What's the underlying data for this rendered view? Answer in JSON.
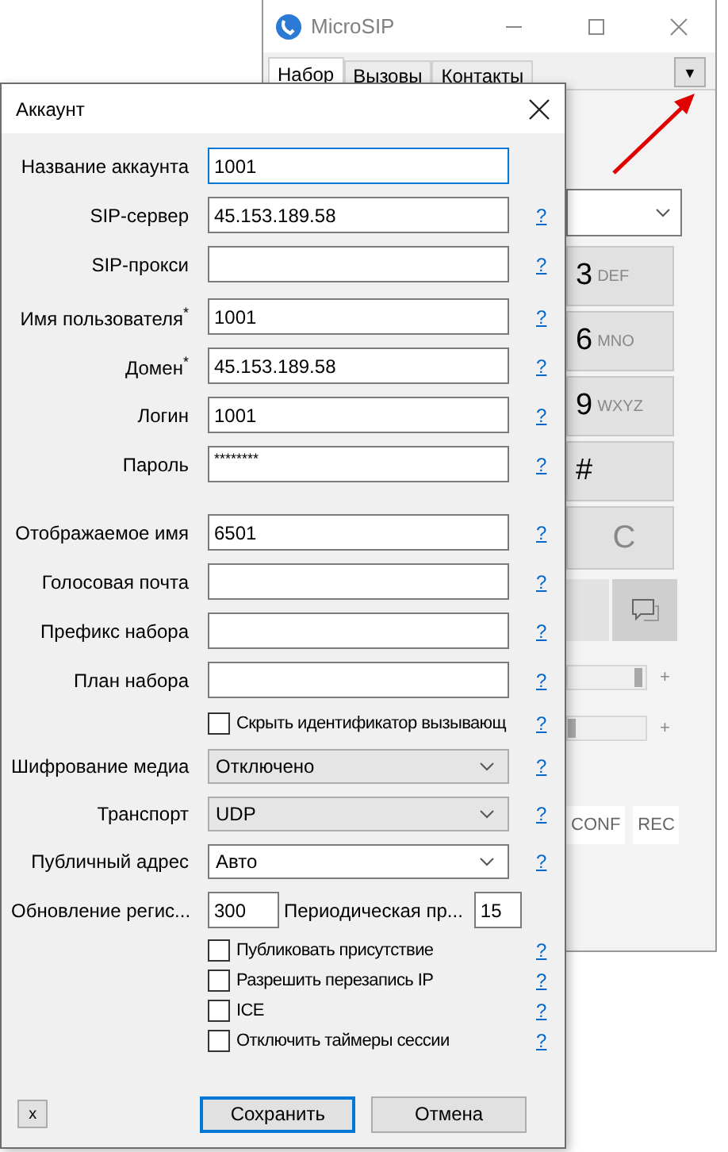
{
  "main_window": {
    "title": "MicroSIP",
    "tabs": [
      {
        "label": "Набор",
        "selected": true
      },
      {
        "label": "Вызовы",
        "selected": false
      },
      {
        "label": "Контакты",
        "selected": false
      }
    ],
    "menu_button": "▼",
    "keypad": [
      {
        "kind": "digit",
        "digit": "3",
        "letters": "DEF"
      },
      {
        "kind": "digit",
        "digit": "6",
        "letters": "MNO"
      },
      {
        "kind": "digit",
        "digit": "9",
        "letters": "WXYZ"
      },
      {
        "kind": "digit",
        "digit": "#"
      },
      {
        "kind": "clear",
        "digit": "C"
      }
    ],
    "sliders": [
      {
        "level": 0.95,
        "plus": "+"
      },
      {
        "level": 0,
        "plus": "+"
      }
    ],
    "buttons": [
      "CONF",
      "REC"
    ]
  },
  "dialog": {
    "title": "Аккаунт",
    "sections": [
      {
        "rows": [
          {
            "kind": "text",
            "label": "Название аккаунта",
            "value": "1001",
            "focused": true
          },
          {
            "kind": "text",
            "label": "SIP-сервер",
            "value": "45.153.189.58",
            "help": "?"
          },
          {
            "kind": "text",
            "label": "SIP-прокси",
            "help": "?"
          }
        ]
      },
      {
        "rows": [
          {
            "kind": "text",
            "label": "Имя пользователя$^{*}$",
            "value": "1001",
            "help": "?"
          },
          {
            "kind": "text",
            "label": "Домен$^{*}$",
            "value": "45.153.189.58",
            "help": "?"
          },
          {
            "kind": "text",
            "label": "Логин",
            "value": "1001",
            "help": "?"
          },
          {
            "kind": "password",
            "label": "Пароль",
            "value": "********",
            "help": "?"
          }
        ]
      },
      {
        "rows": [
          {
            "kind": "text",
            "label": "Отображаемое имя",
            "value": "6501",
            "help": "?"
          },
          {
            "kind": "text",
            "label": "Голосовая почта",
            "help": "?"
          },
          {
            "kind": "text",
            "label": "Префикс набора",
            "help": "?"
          },
          {
            "kind": "text",
            "label": "План набора",
            "help": "?"
          },
          {
            "kind": "checkbox",
            "text": "Скрыть идентификатор вызывающ",
            "checked": false,
            "help": "?"
          },
          {
            "kind": "select",
            "label": "Шифрование медиа",
            "value": "Отключено",
            "editable": false,
            "help": "?"
          },
          {
            "kind": "select",
            "label": "Транспорт",
            "value": "UDP",
            "editable": false,
            "help": "?"
          },
          {
            "kind": "select",
            "label": "Публичный адрес",
            "value": "Авто",
            "editable": true,
            "help": "?"
          },
          {
            "kind": "pair",
            "label": "Обновление регис...",
            "value": "300",
            "label2": "Периодическая пр...",
            "value2": "15"
          }
        ]
      },
      {
        "rows": [
          {
            "kind": "checkbox",
            "text": "Публиковать присутствие",
            "checked": false,
            "help": "?"
          },
          {
            "kind": "checkbox",
            "text": "Разрешить перезапись IP",
            "checked": false,
            "help": "?"
          },
          {
            "kind": "checkbox",
            "text": "ICE",
            "checked": false,
            "help": "?"
          },
          {
            "kind": "checkbox",
            "text": "Отключить таймеры сессии",
            "checked": false,
            "help": "?"
          }
        ]
      }
    ],
    "small_button": "x",
    "buttons": [
      {
        "label": "Сохранить",
        "default": true
      },
      {
        "label": "Отмена",
        "default": false
      }
    ]
  }
}
